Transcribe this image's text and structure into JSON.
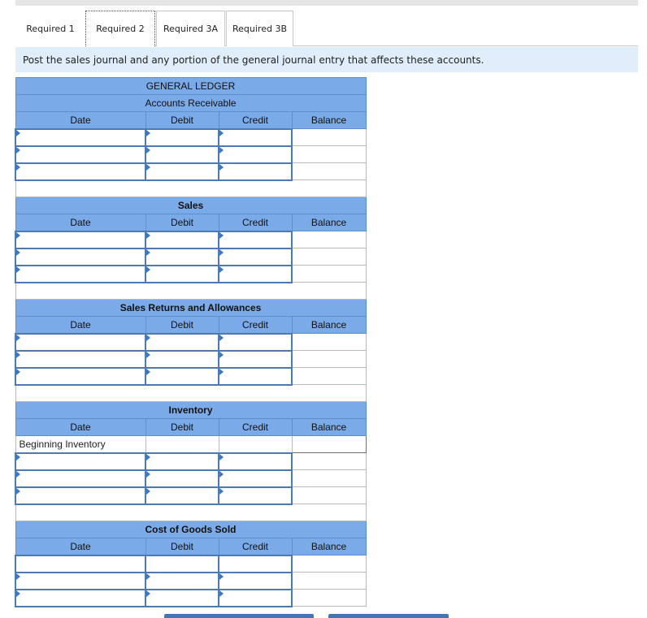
{
  "tabs": [
    {
      "label": "Required 1"
    },
    {
      "label": "Required 2"
    },
    {
      "label": "Required 3A"
    },
    {
      "label": "Required 3B"
    }
  ],
  "instruction": "Post the sales journal and any portion of the general journal entry that affects these accounts.",
  "ledger": {
    "title": "GENERAL LEDGER",
    "columns": {
      "date": "Date",
      "debit": "Debit",
      "credit": "Credit",
      "balance": "Balance"
    },
    "accounts": [
      {
        "name": "Accounts Receivable"
      },
      {
        "name": "Sales"
      },
      {
        "name": "Sales Returns and Allowances"
      },
      {
        "name": "Inventory",
        "first_row_label": "Beginning Inventory"
      },
      {
        "name": "Cost of Goods Sold"
      }
    ]
  },
  "colors": {
    "header_blue": "#7aaae8",
    "input_border": "#4d7ab3",
    "instruction_bg": "#dfeefa",
    "button_blue": "#3f77b7"
  }
}
